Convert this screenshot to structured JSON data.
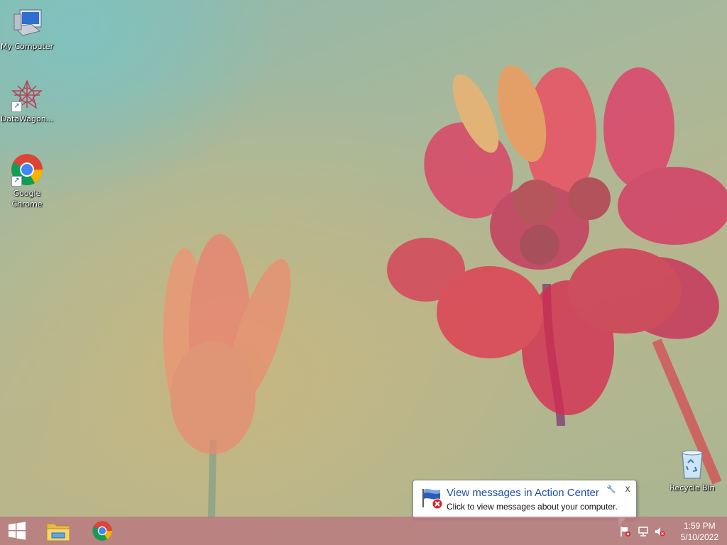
{
  "desktop": {
    "icons": [
      {
        "name": "computer-icon",
        "label": "My Computer"
      },
      {
        "name": "datawagon-icon",
        "label": "DataWagon..."
      },
      {
        "name": "chrome-icon",
        "label": "Google Chrome"
      },
      {
        "name": "recycle-bin-icon",
        "label": "Recycle Bin"
      }
    ]
  },
  "taskbar": {
    "pinned": [
      {
        "name": "start-button",
        "icon": "windows-logo-icon"
      },
      {
        "name": "file-explorer-button",
        "icon": "folder-icon"
      },
      {
        "name": "chrome-taskbar-button",
        "icon": "chrome-icon"
      }
    ],
    "tray": {
      "icons": [
        "action-center-flag-icon",
        "network-icon",
        "volume-muted-icon"
      ],
      "time": "1:59 PM",
      "date": "5/10/2022"
    }
  },
  "notification": {
    "title": "View messages in Action Center",
    "message": "Click to view messages about your computer.",
    "close_glyph": "x",
    "settings_glyph": "🔧"
  },
  "colors": {
    "taskbar": "#ba7880",
    "notification_title": "#1f4fb0"
  }
}
